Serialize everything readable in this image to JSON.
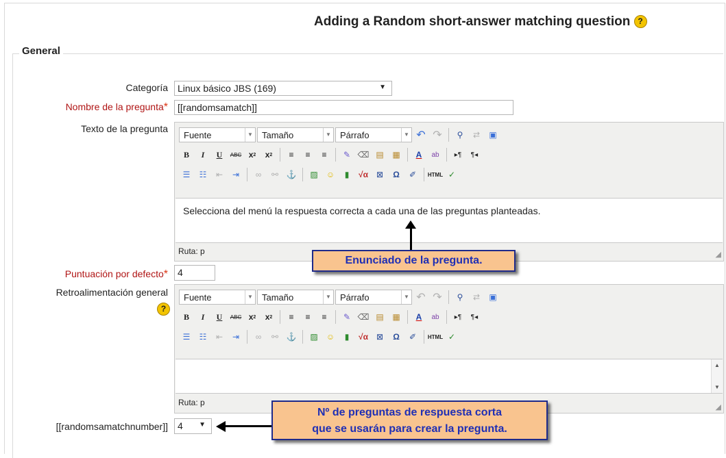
{
  "page": {
    "title": "Adding a Random short-answer matching question",
    "help_glyph": "?",
    "section_legend": "General"
  },
  "form": {
    "category": {
      "label": "Categoría",
      "value": "Linux básico JBS (169)"
    },
    "name": {
      "label": "Nombre de la pregunta",
      "value": "[[randomsamatch]]",
      "required": true
    },
    "question_text": {
      "label": "Texto de la pregunta",
      "content": "Selecciona del menú la respuesta correcta a cada una de las preguntas planteadas.",
      "path": "Ruta: p"
    },
    "default_grade": {
      "label": "Puntuación por defecto",
      "value": "4",
      "required": true
    },
    "general_feedback": {
      "label": "Retroalimentación general",
      "content": "",
      "path": "Ruta: p"
    },
    "choose": {
      "label": "[[randomsamatchnumber]]",
      "value": "4"
    }
  },
  "editor_toolbar": {
    "font_label": "Fuente",
    "size_label": "Tamaño",
    "format_label": "Párrafo",
    "icons_row1": [
      "undo-icon",
      "redo-icon",
      "find-icon",
      "replace-icon",
      "fullscreen-icon"
    ],
    "icons_row2": [
      "bold-icon",
      "italic-icon",
      "underline-icon",
      "strikethrough-icon",
      "subscript-icon",
      "superscript-icon",
      "align-left-icon",
      "align-center-icon",
      "align-right-icon",
      "clean-icon",
      "eraser-icon",
      "paste-text-icon",
      "paste-word-icon",
      "text-color-icon",
      "highlight-icon",
      "ltr-icon",
      "rtl-icon"
    ],
    "icons_row3": [
      "bullet-list-icon",
      "numbered-list-icon",
      "outdent-icon",
      "indent-icon",
      "link-icon",
      "unlink-icon",
      "anchor-icon",
      "image-icon",
      "emoticon-icon",
      "media-icon",
      "math-icon",
      "nolink-icon",
      "omega-icon",
      "edit-icon",
      "html-icon",
      "spellcheck-icon"
    ]
  },
  "annotations": {
    "callout1": "Enunciado de la pregunta.",
    "callout2_line1": "Nº de preguntas de respuesta corta",
    "callout2_line2": "que se usarán para crear la pregunta."
  },
  "colors": {
    "required": "#b01515",
    "callout_bg": "#f9c48f",
    "callout_text": "#1f2fb5"
  }
}
